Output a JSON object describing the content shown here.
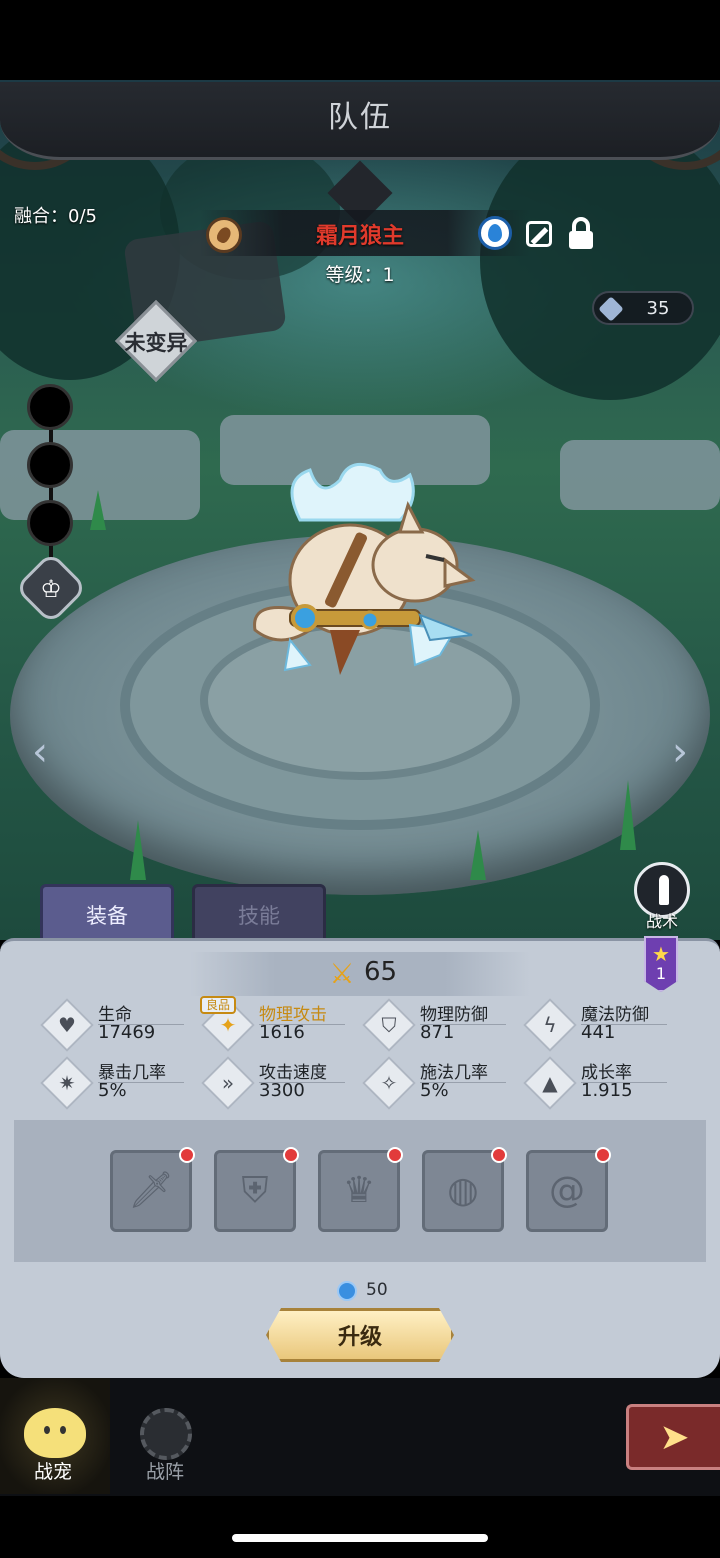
{
  "header": {
    "title": "队伍"
  },
  "fusion": "融合：0/5",
  "pet": {
    "name": "霜月狼主",
    "level_text": "等级：1",
    "mutation": "未变异",
    "element_icon": "water-drop-icon"
  },
  "currency": {
    "value": "35"
  },
  "tactic": {
    "label": "战术"
  },
  "star_badge": {
    "star": "★",
    "count": "1"
  },
  "tabs": [
    {
      "label": "装备",
      "active": true
    },
    {
      "label": "技能",
      "active": false
    }
  ],
  "power": {
    "value": "65"
  },
  "quality_tag": "良品",
  "stats": [
    {
      "label": "生命",
      "value": "17469",
      "icon": "heart-icon"
    },
    {
      "label": "物理攻击",
      "value": "1616",
      "icon": "claw-icon"
    },
    {
      "label": "物理防御",
      "value": "871",
      "icon": "shield-icon"
    },
    {
      "label": "魔法防御",
      "value": "441",
      "icon": "magic-shield-icon"
    },
    {
      "label": "暴击几率",
      "value": "5%",
      "icon": "crit-icon"
    },
    {
      "label": "攻击速度",
      "value": "3300",
      "icon": "speed-icon"
    },
    {
      "label": "施法几率",
      "value": "5%",
      "icon": "cast-icon"
    },
    {
      "label": "成长率",
      "value": "1.915",
      "icon": "growth-icon"
    }
  ],
  "equipment_slots": [
    {
      "name": "weapon",
      "icon": "sword-icon",
      "has_alert": true
    },
    {
      "name": "armor",
      "icon": "armor-icon",
      "has_alert": true
    },
    {
      "name": "helmet",
      "icon": "helmet-icon",
      "has_alert": true
    },
    {
      "name": "ring",
      "icon": "ring-icon",
      "has_alert": true
    },
    {
      "name": "charm",
      "icon": "spiral-icon",
      "has_alert": true
    }
  ],
  "upgrade": {
    "cost": "50",
    "label": "升级"
  },
  "bottom_nav": [
    {
      "label": "战宠",
      "active": true
    },
    {
      "label": "战阵",
      "active": false
    }
  ]
}
